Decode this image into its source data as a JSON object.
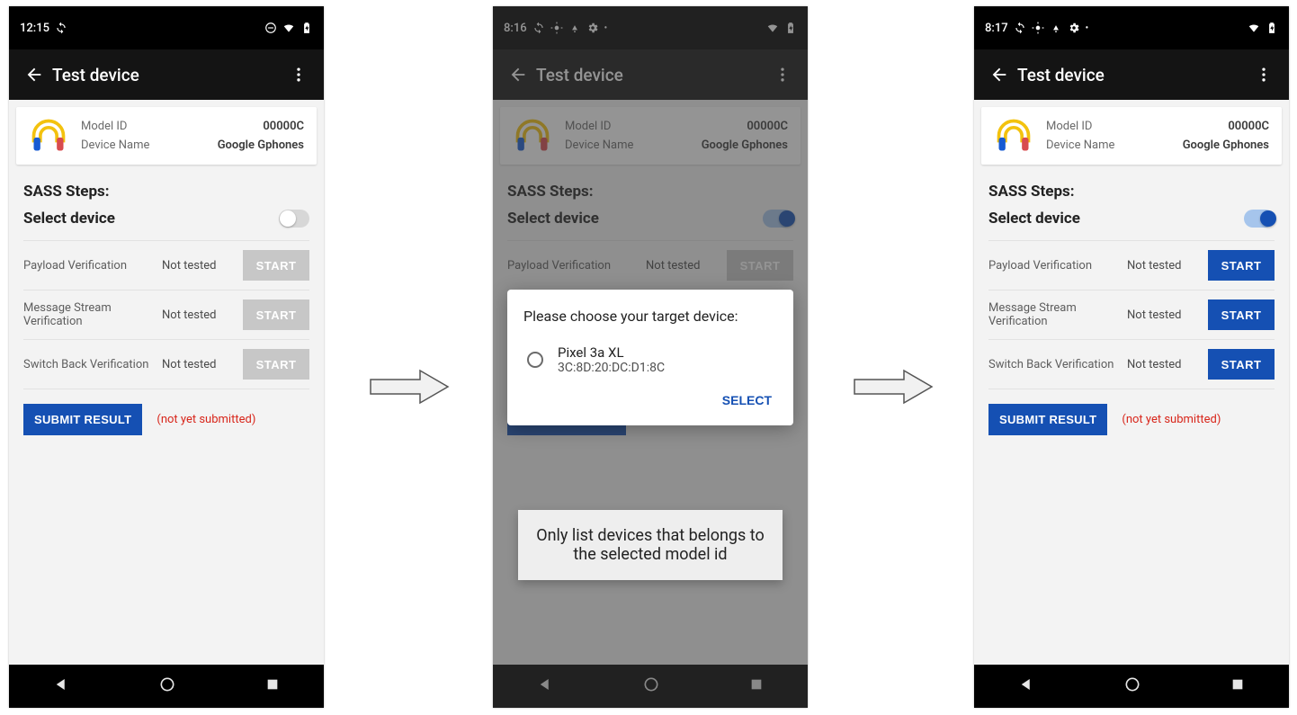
{
  "statusbar": {
    "times": {
      "p1": "12:15",
      "p2": "8:16",
      "p3": "8:17"
    }
  },
  "appbar": {
    "title": "Test device"
  },
  "device": {
    "model_id_label": "Model ID",
    "model_id_value": "00000C",
    "device_name_label": "Device Name",
    "device_name_value": "Google Gphones"
  },
  "sass_steps_label": "SASS Steps:",
  "select_device_label": "Select device",
  "steps": [
    {
      "name": "Payload Verification",
      "status": "Not tested",
      "btn": "START"
    },
    {
      "name": "Message Stream Verification",
      "status": "Not tested",
      "btn": "START"
    },
    {
      "name": "Switch Back Verification",
      "status": "Not tested",
      "btn": "START"
    }
  ],
  "submit_label": "SUBMIT RESULT",
  "not_submitted_label": "(not yet submitted)",
  "dialog": {
    "title": "Please choose your target device:",
    "option_name": "Pixel 3a XL",
    "option_mac": "3C:8D:20:DC:D1:8C",
    "select_label": "SELECT"
  },
  "callout_text": "Only list devices that belongs to the selected model id"
}
